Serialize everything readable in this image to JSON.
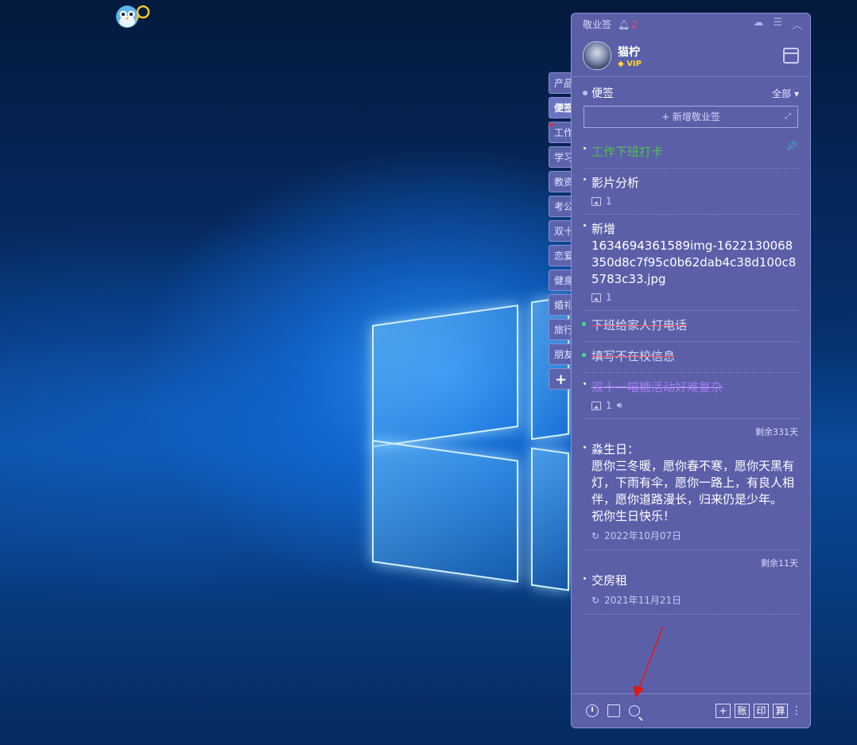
{
  "app": {
    "title": "敬业签",
    "notification_count": "2"
  },
  "user": {
    "name": "猫柠",
    "vip_label": "VIP"
  },
  "category_tabs": [
    {
      "label": "产品",
      "active": false
    },
    {
      "label": "便签",
      "active": true
    },
    {
      "label": "工作",
      "active": false,
      "dot": true
    },
    {
      "label": "学习",
      "active": false
    },
    {
      "label": "教资",
      "active": false
    },
    {
      "label": "考公",
      "active": false
    },
    {
      "label": "双十",
      "active": false
    },
    {
      "label": "恋爱",
      "active": false
    },
    {
      "label": "健身",
      "active": false
    },
    {
      "label": "婚礼",
      "active": false
    },
    {
      "label": "旅行",
      "active": false
    },
    {
      "label": "朋友",
      "active": false
    },
    {
      "label": "+",
      "active": false
    }
  ],
  "section": {
    "title": "便签",
    "filter": "全部 ▾",
    "new_note_label": "+ 新增敬业签"
  },
  "notes": [
    {
      "text": "工作下班打卡",
      "style": "green",
      "pinned": true
    },
    {
      "text": "影片分析",
      "style": "normal",
      "images": "1"
    },
    {
      "text": "新增\n1634694361589img-1622130068350d8c7f95c0b62dab4c38d100c85783c33.jpg",
      "style": "normal",
      "images": "1"
    },
    {
      "text": "下班给家人打电话",
      "style": "done"
    },
    {
      "text": "填写不在校信息",
      "style": "done"
    },
    {
      "text": "双十一喵糖活动好难复杂",
      "style": "purple-done",
      "images": "1",
      "audio": true
    },
    {
      "text": "淼生日：\n愿你三冬暖，愿你春不寒，愿你天黑有灯，下雨有伞，愿你一路上，有良人相伴，愿你道路漫长，归来仍是少年。\n祝你生日快乐！",
      "style": "normal",
      "remain": "剩余331天",
      "date": "2022年10月07日"
    },
    {
      "text": "交房租",
      "style": "normal",
      "remain": "剩余11天",
      "date": "2021年11月21日"
    }
  ],
  "footer": {
    "right_buttons": [
      "+",
      "账",
      "印",
      "算"
    ]
  },
  "colors": {
    "panel": "#5b5fa8",
    "accent_green": "#4ec24a",
    "accent_purple": "#a07df0",
    "pin": "#27d1c9",
    "arrow": "#e01818"
  }
}
